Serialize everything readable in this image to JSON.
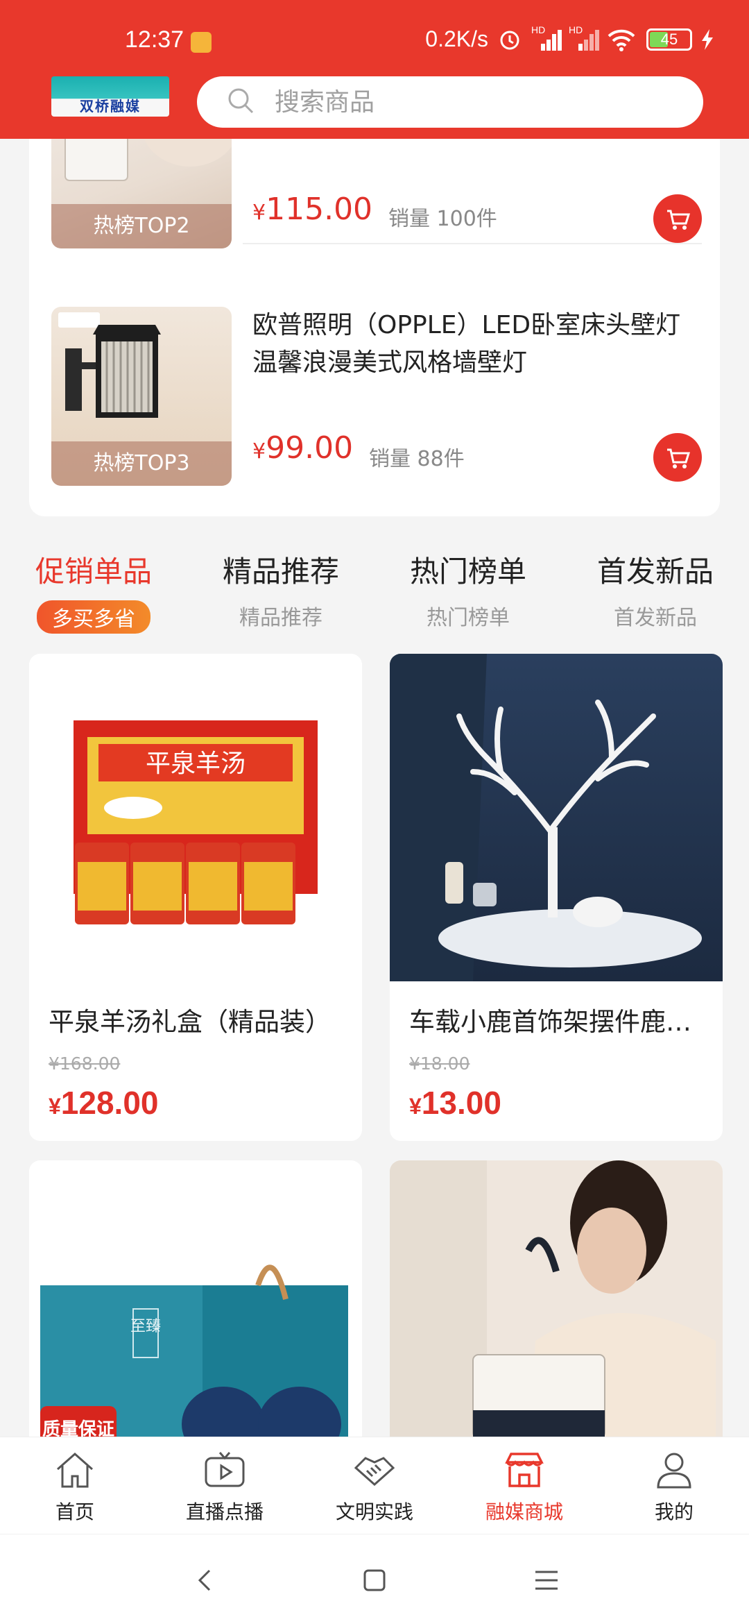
{
  "status": {
    "time": "12:37",
    "speed": "0.2K/s",
    "battery": "45",
    "net1": "HD",
    "net2": "HD"
  },
  "search": {
    "placeholder": "搜索商品"
  },
  "logo": {
    "text": "双桥融媒"
  },
  "hot_list": [
    {
      "badge": "热榜TOP2",
      "price": "115.00",
      "currency": "¥",
      "sales": "销量 100件"
    },
    {
      "badge": "热榜TOP3",
      "title": "欧普照明（OPPLE）LED卧室床头壁灯 温馨浪漫美式风格墙壁灯",
      "price": "99.00",
      "currency": "¥",
      "sales": "销量 88件"
    }
  ],
  "tabs": [
    {
      "label": "促销单品",
      "sub": "多买多省"
    },
    {
      "label": "精品推荐",
      "sub": "精品推荐"
    },
    {
      "label": "热门榜单",
      "sub": "热门榜单"
    },
    {
      "label": "首发新品",
      "sub": "首发新品"
    }
  ],
  "products": [
    {
      "name": "平泉羊汤礼盒（精品装）",
      "orig": "¥168.00",
      "currency": "¥",
      "price": "128.00",
      "img_label": "平泉羊汤"
    },
    {
      "name": "车载小鹿首饰架摆件鹿…",
      "orig": "¥18.00",
      "currency": "¥",
      "price": "13.00"
    },
    {
      "img_label": "至臻",
      "badge": "质量保证"
    },
    {}
  ],
  "bottom_nav": [
    {
      "label": "首页",
      "icon": "home-icon"
    },
    {
      "label": "直播点播",
      "icon": "tv-play-icon"
    },
    {
      "label": "文明实践",
      "icon": "handshake-icon"
    },
    {
      "label": "融媒商城",
      "icon": "store-icon"
    },
    {
      "label": "我的",
      "icon": "user-icon"
    }
  ],
  "colors": {
    "brand": "#e8382c",
    "price": "#e0312a",
    "tab_badge": "#f26a28"
  }
}
